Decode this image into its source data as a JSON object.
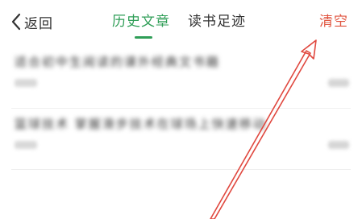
{
  "header": {
    "back_label": "返回",
    "tabs": [
      {
        "label": "历史文章",
        "active": true
      },
      {
        "label": "读书足迹",
        "active": false
      }
    ],
    "clear_label": "清空"
  },
  "list": {
    "items": [
      {
        "title": "适合初中生阅读的课外经典文书籍"
      },
      {
        "title": "篮球技术 掌握滑步技术在球场上快速移动"
      }
    ]
  },
  "colors": {
    "active_tab": "#2f9e57",
    "clear": "#e0543f",
    "annotation_arrow": "#e0483f"
  }
}
